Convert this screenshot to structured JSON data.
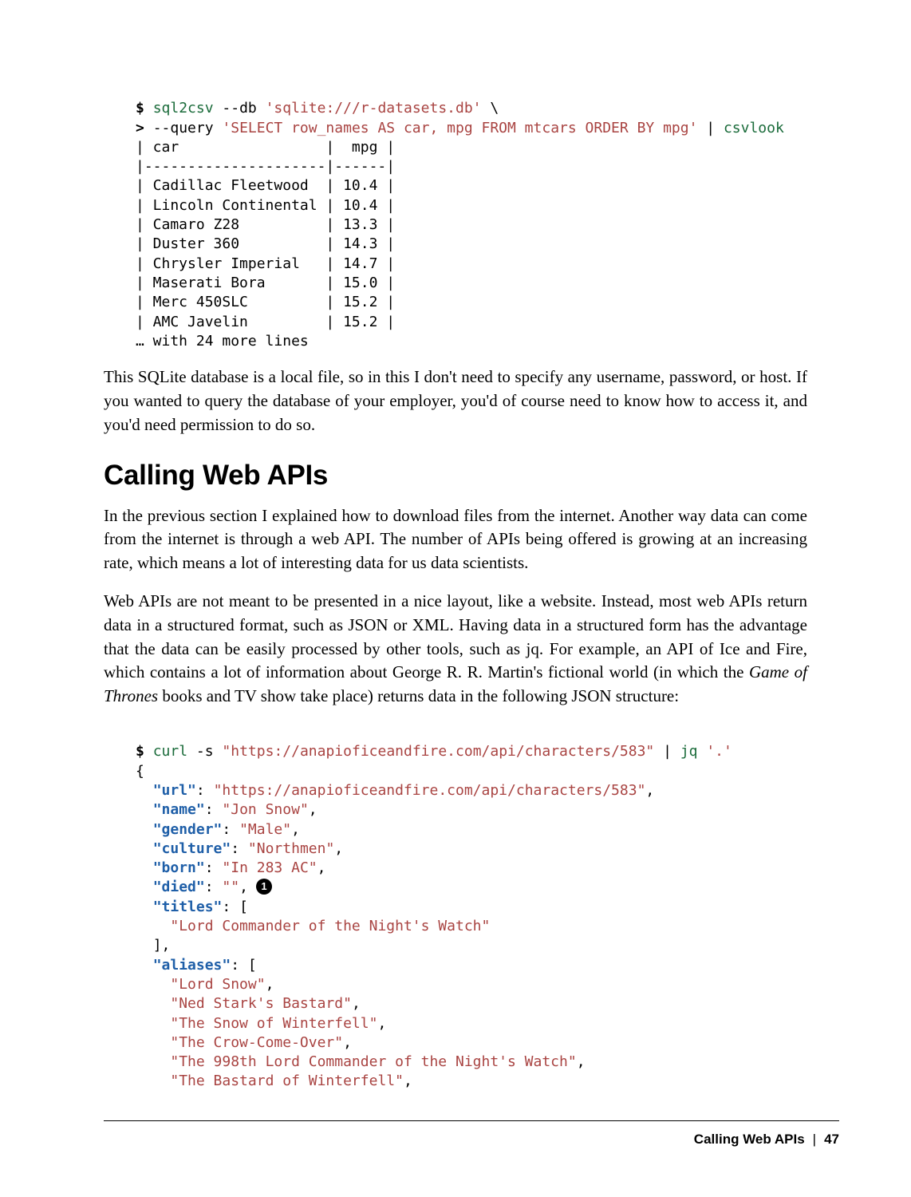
{
  "code1": {
    "prompt1": "$",
    "cmd1": "sql2csv",
    "db_flag": "--db",
    "db_str": "'sqlite:///r-datasets.db'",
    "backslash": "\\",
    "prompt2": ">",
    "query_flag": "--query",
    "query_str": "'SELECT row_names AS car, mpg FROM mtcars ORDER BY mpg'",
    "pipe": "|",
    "csvlook": "csvlook",
    "header": "| car                 |  mpg |",
    "rule": "|---------------------|------|",
    "rows": [
      "| Cadillac Fleetwood  | 10.4 |",
      "| Lincoln Continental | 10.4 |",
      "| Camaro Z28          | 13.3 |",
      "| Duster 360          | 14.3 |",
      "| Chrysler Imperial   | 14.7 |",
      "| Maserati Bora       | 15.0 |",
      "| Merc 450SLC         | 15.2 |",
      "| AMC Javelin         | 15.2 |"
    ],
    "more": "… with 24 more lines"
  },
  "para1": "This SQLite database is a local file, so in this I don't need to specify any username, password, or host. If you wanted to query the database of your employer, you'd of course need to know how to access it, and you'd need permission to do so.",
  "heading": "Calling Web APIs",
  "para2": "In the previous section I explained how to download files from the internet. Another way data can come from the internet is through a web API. The number of APIs being offered is growing at an increasing rate, which means a lot of interesting data for us data scientists.",
  "para3_a": "Web APIs are not meant to be presented in a nice layout, like a website. Instead, most web APIs return data in a structured format, such as JSON or XML. Having data in a structured form has the advantage that the data can be easily processed by other tools, such as jq. For example, an API of Ice and Fire, which contains a lot of information about George R. R. Martin's fictional world (in which the ",
  "para3_em": "Game of Thrones",
  "para3_b": " books and TV show take place) returns data in the following JSON structure:",
  "code2": {
    "prompt": "$",
    "curl": "curl",
    "flags": "-s",
    "url": "\"https://anapioficeandfire.com/api/characters/583\"",
    "pipe": "|",
    "jq": "jq",
    "jqarg": "'.'",
    "open": "{",
    "k_url": "\"url\"",
    "v_url": "\"https://anapioficeandfire.com/api/characters/583\"",
    "k_name": "\"name\"",
    "v_name": "\"Jon Snow\"",
    "k_gender": "\"gender\"",
    "v_gender": "\"Male\"",
    "k_cult": "\"culture\"",
    "v_cult": "\"Northmen\"",
    "k_born": "\"born\"",
    "v_born": "\"In 283 AC\"",
    "k_died": "\"died\"",
    "v_died": "\"\"",
    "callout": "1",
    "k_titles": "\"titles\"",
    "titles": [
      "\"Lord Commander of the Night's Watch\""
    ],
    "arr_close": "],",
    "k_aliases": "\"aliases\"",
    "aliases": [
      "\"Lord Snow\"",
      "\"Ned Stark's Bastard\"",
      "\"The Snow of Winterfell\"",
      "\"The Crow-Come-Over\"",
      "\"The 998th Lord Commander of the Night's Watch\"",
      "\"The Bastard of Winterfell\""
    ]
  },
  "chart_data": {
    "type": "table",
    "title": "mtcars ORDER BY mpg",
    "columns": [
      "car",
      "mpg"
    ],
    "rows": [
      [
        "Cadillac Fleetwood",
        10.4
      ],
      [
        "Lincoln Continental",
        10.4
      ],
      [
        "Camaro Z28",
        13.3
      ],
      [
        "Duster 360",
        14.3
      ],
      [
        "Chrysler Imperial",
        14.7
      ],
      [
        "Maserati Bora",
        15.0
      ],
      [
        "Merc 450SLC",
        15.2
      ],
      [
        "AMC Javelin",
        15.2
      ]
    ],
    "more_lines": 24
  },
  "footer": {
    "section": "Calling Web APIs",
    "page": "47"
  }
}
